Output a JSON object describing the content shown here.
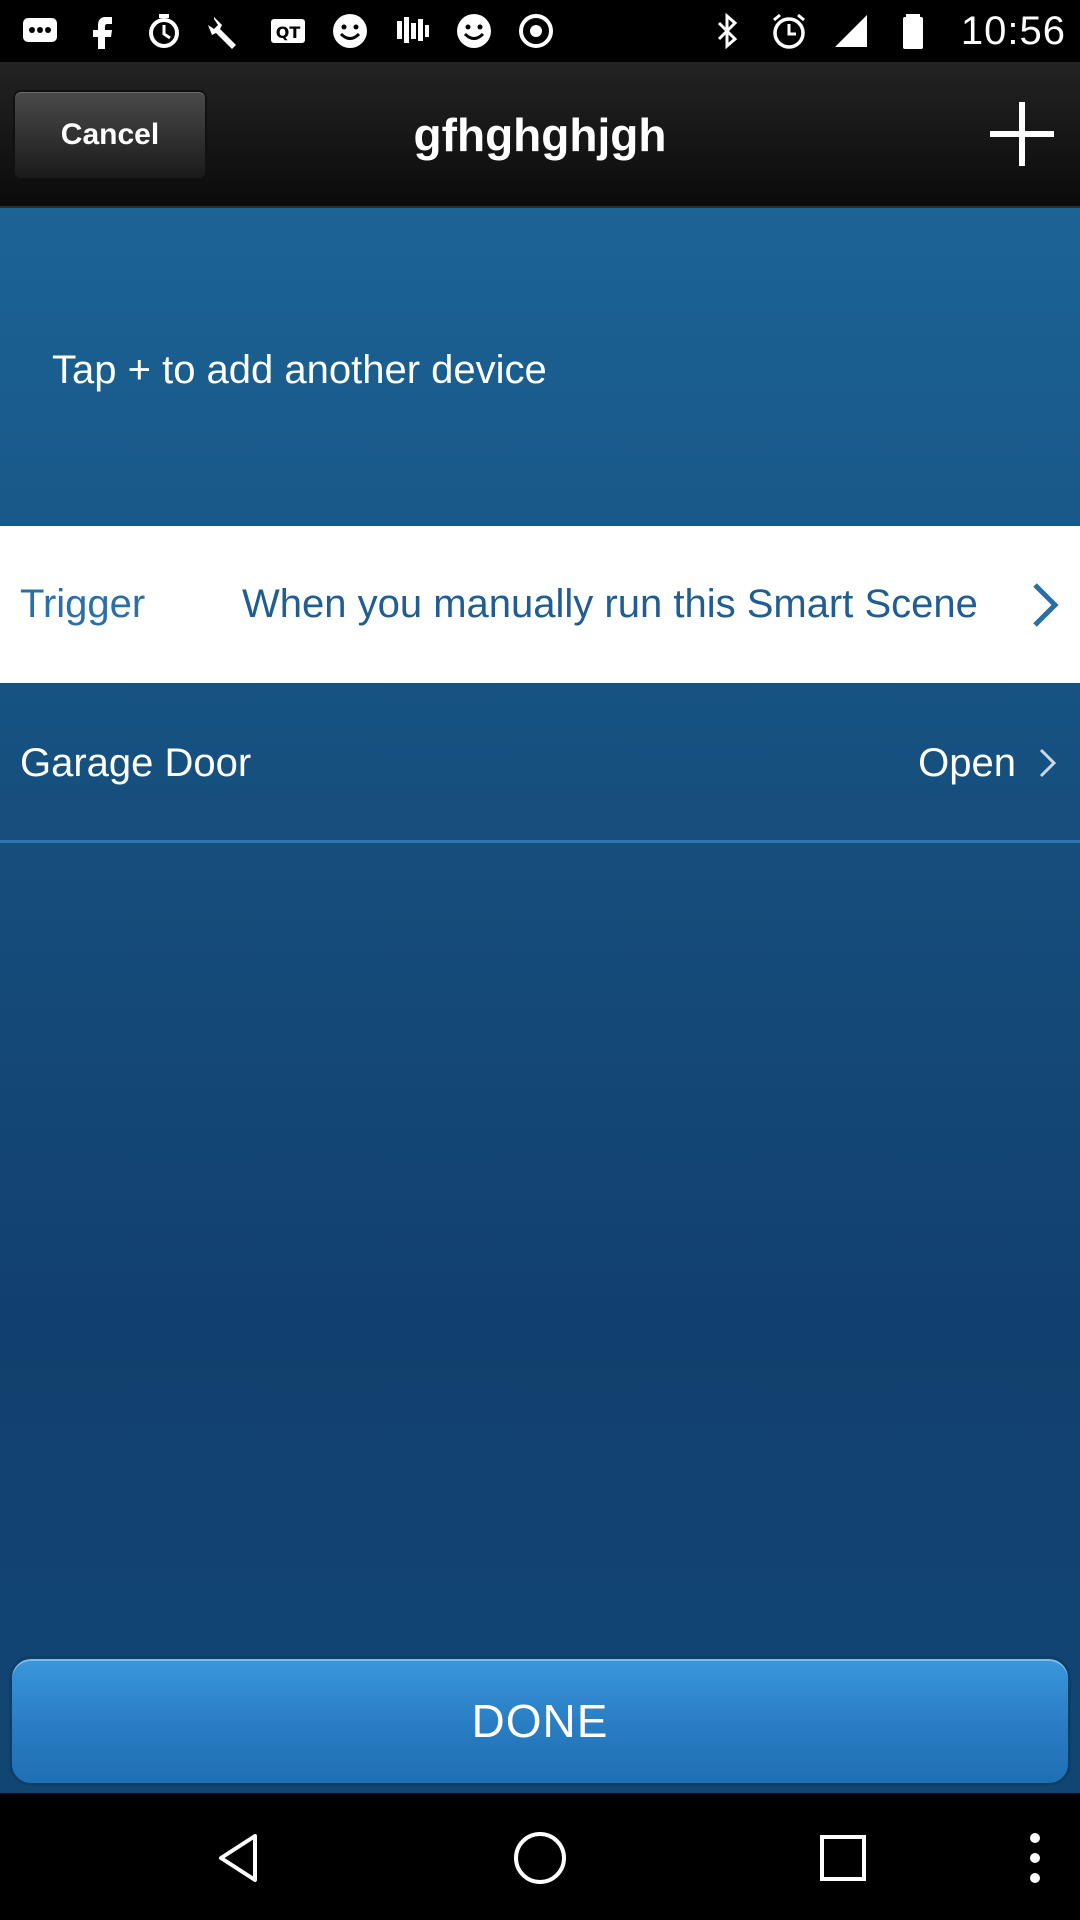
{
  "status_bar": {
    "time": "10:56",
    "left_icons": [
      "messages-icon",
      "facebook-icon",
      "alarm-icon",
      "wrench-icon",
      "qq-icon",
      "smiley-icon",
      "stitcher-icon",
      "smiley-icon",
      "circle-icon"
    ],
    "right_icons": [
      "bluetooth-icon",
      "alarm-clock-icon",
      "signal-icon",
      "battery-icon"
    ]
  },
  "header": {
    "cancel_label": "Cancel",
    "title": "gfhghghjgh",
    "add_icon": "plus-icon"
  },
  "main": {
    "hint": "Tap + to add another device",
    "trigger": {
      "label": "Trigger",
      "value": "When you manually run this Smart Scene"
    },
    "device": {
      "name": "Garage Door",
      "state": "Open"
    },
    "done_label": "DONE"
  },
  "colors": {
    "accent_blue": "#2a7ec4",
    "background_blue": "#16507f",
    "trigger_text": "#1f5d92"
  },
  "nav_bar": {
    "icons": [
      "back-icon",
      "home-icon",
      "recents-icon",
      "menu-icon"
    ]
  }
}
